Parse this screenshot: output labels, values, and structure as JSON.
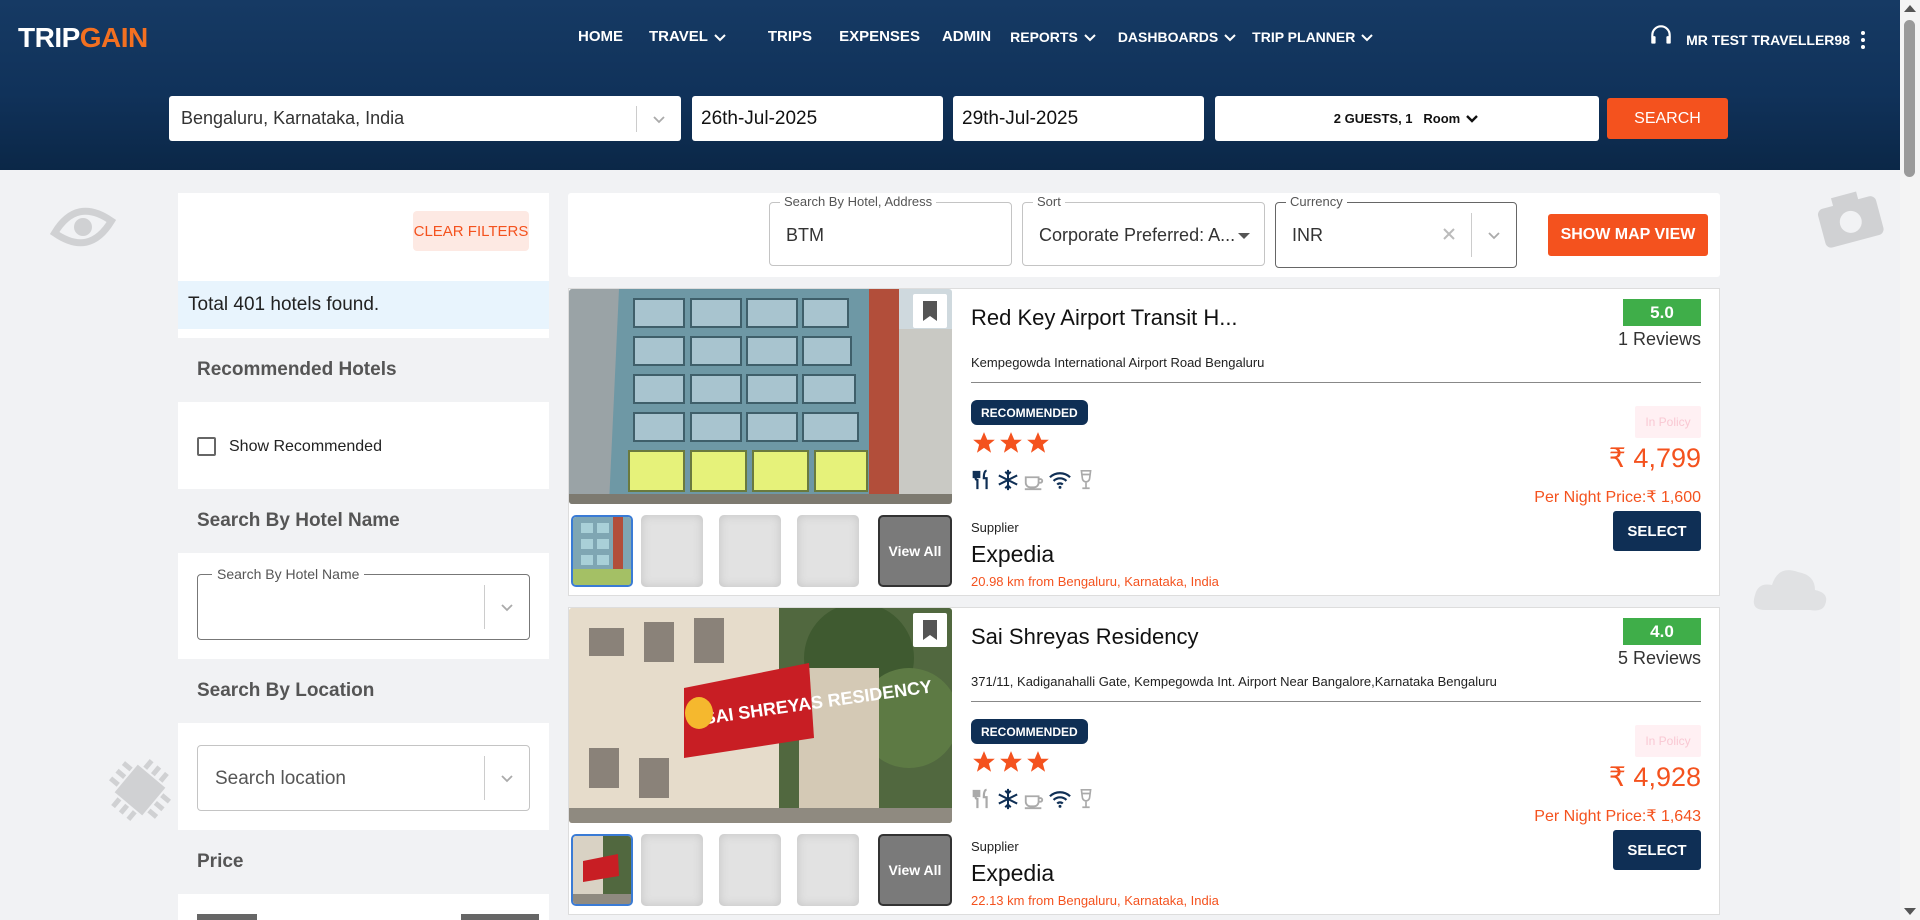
{
  "brand": {
    "logo_part1": "TRIP",
    "logo_part2": "GAIN",
    "accent": "#f4521e",
    "navy": "#0f2f55"
  },
  "nav": {
    "items": [
      {
        "label": "HOME",
        "dropdown": false
      },
      {
        "label": "TRAVEL",
        "dropdown": true
      },
      {
        "label": "TRIPS",
        "dropdown": false
      },
      {
        "label": "EXPENSES",
        "dropdown": false
      },
      {
        "label": "ADMIN",
        "dropdown": false
      },
      {
        "label": "REPORTS",
        "dropdown": true
      },
      {
        "label": "DASHBOARDS",
        "dropdown": true
      },
      {
        "label": "TRIP PLANNER",
        "dropdown": true
      }
    ],
    "support_icon": "headset-icon",
    "user_name": "MR TEST TRAVELLER98"
  },
  "search": {
    "destination": "Bengaluru, Karnataka, India",
    "check_in": "26th-Jul-2025",
    "check_out": "29th-Jul-2025",
    "guests": "2 GUESTS, 1",
    "rooms_label": "Room",
    "search_label": "SEARCH"
  },
  "filters": {
    "clear_label": "CLEAR FILTERS",
    "total_text": "Total 401 hotels found.",
    "recommended_title": "Recommended Hotels",
    "show_recommended_label": "Show Recommended",
    "show_recommended_checked": false,
    "hotel_name_title": "Search By Hotel Name",
    "hotel_name_legend": "Search By Hotel Name",
    "location_title": "Search By Location",
    "location_placeholder": "Search location",
    "price_title": "Price"
  },
  "toolbar": {
    "search_legend": "Search By Hotel, Address",
    "search_value": "BTM",
    "sort_legend": "Sort",
    "sort_value": "Corporate Preferred: A...",
    "currency_legend": "Currency",
    "currency_value": "INR",
    "map_button": "SHOW MAP VIEW"
  },
  "hotels": [
    {
      "name": "Red Key Airport Transit H...",
      "address": "Kempegowda International Airport Road Bengaluru",
      "rating": "5.0",
      "reviews": "1 Reviews",
      "badge": "RECOMMENDED",
      "stars": 3,
      "policy": "In Policy",
      "price": "₹ 4,799",
      "per_night": "Per Night Price:₹ 1,600",
      "select_label": "SELECT",
      "supplier_label": "Supplier",
      "supplier": "Expedia",
      "distance": "20.98 km from Bengaluru, Karnataka, India",
      "view_all": "View All",
      "amenities": [
        "restaurant-icon",
        "ac-icon",
        "coffee-icon",
        "wifi-icon",
        "bar-icon"
      ]
    },
    {
      "name": "Sai Shreyas Residency",
      "address": "371/11, Kadiganahalli Gate, Kempegowda Int. Airport Near Bangalore,Karnataka Bengaluru",
      "rating": "4.0",
      "reviews": "5 Reviews",
      "badge": "RECOMMENDED",
      "stars": 3,
      "policy": "In Policy",
      "price": "₹ 4,928",
      "per_night": "Per Night Price:₹ 1,643",
      "select_label": "SELECT",
      "supplier_label": "Supplier",
      "supplier": "Expedia",
      "distance": "22.13 km from Bengaluru, Karnataka, India",
      "view_all": "View All",
      "sign_text": "SAI SHREYAS RESIDENCY",
      "amenities": [
        "restaurant-icon",
        "ac-icon",
        "coffee-icon",
        "wifi-icon",
        "bar-icon"
      ]
    }
  ]
}
